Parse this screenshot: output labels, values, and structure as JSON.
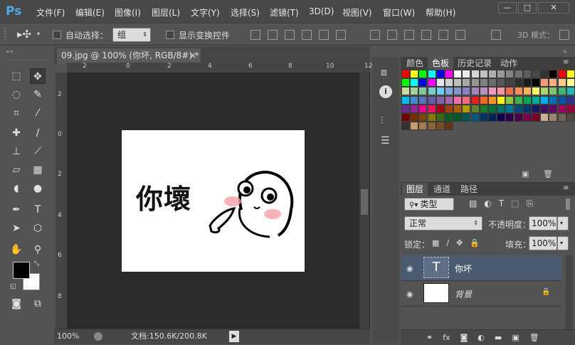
{
  "app": {
    "logo": "Ps"
  },
  "menu": [
    "文件(F)",
    "编辑(E)",
    "图像(I)",
    "图层(L)",
    "文字(Y)",
    "选择(S)",
    "滤镜(T)",
    "3D(D)",
    "视图(V)",
    "窗口(W)",
    "帮助(H)"
  ],
  "window_controls": {
    "minimize": "—",
    "maximize": "□",
    "close": "✕"
  },
  "options": {
    "auto_select_label": "自动选择：",
    "auto_select_value": "组",
    "show_transform_label": "显示变换控件",
    "mode_3d_label": "3D 模式："
  },
  "document": {
    "tab_title": "09.jpg @ 100% (你坏, RGB/8#) *",
    "close": "×",
    "zoom": "100%",
    "doc_size": "文档:150.6K/200.8K",
    "ruler_h_labels": [
      "2",
      "0",
      "2",
      "4",
      "6",
      "8",
      "10",
      "12"
    ],
    "ruler_v_labels": [
      "2",
      "0",
      "2",
      "4",
      "6",
      "8"
    ],
    "canvas_text": "你壞"
  },
  "swatches_panel": {
    "tabs": [
      "颜色",
      "色板",
      "历史记录",
      "动作"
    ],
    "active_tab": "色板",
    "colors": [
      [
        "#ff0000",
        "#ffff00",
        "#00ff00",
        "#00ffff",
        "#0000ff",
        "#ff00ff",
        "#ffffff",
        "#ebebeb",
        "#d6d6d6",
        "#c2c2c2",
        "#adadad",
        "#999999",
        "#858585",
        "#707070",
        "#5c5c5c",
        "#474747",
        "#333333",
        "#000000",
        "#ff0000",
        "#ffff00"
      ],
      [
        "#00ff00",
        "#00ffff",
        "#0000ff",
        "#ff00ff",
        "#e6e6e6",
        "#d1d1d1",
        "#bdbdbd",
        "#a8a8a8",
        "#949494",
        "#808080",
        "#6b6b6b",
        "#575757",
        "#424242",
        "#2e2e2e",
        "#1a1a1a",
        "#000000",
        "#f7977a",
        "#f9ad81",
        "#fdc68a",
        "#fff79a"
      ],
      [
        "#c4df9b",
        "#a2d39c",
        "#82ca9d",
        "#7bcdc8",
        "#6ecff6",
        "#7ea7d8",
        "#8493ca",
        "#8882be",
        "#a187be",
        "#bc8dbf",
        "#f49ac2",
        "#f6989d",
        "#f26c4f",
        "#f68e55",
        "#fbaf5c",
        "#fff467",
        "#acd372",
        "#7cc576",
        "#3bb878",
        "#1abbb4"
      ],
      [
        "#00bff3",
        "#438ccb",
        "#5574b9",
        "#605ca8",
        "#855fa8",
        "#a763a8",
        "#f06eaa",
        "#f26d7d",
        "#ed1c24",
        "#f26522",
        "#f7941d",
        "#fff200",
        "#8dc73f",
        "#39b54a",
        "#00a651",
        "#00a99d",
        "#00aeef",
        "#0072bc",
        "#0054a6",
        "#2e3192"
      ],
      [
        "#662d91",
        "#92278f",
        "#ec008c",
        "#ed145b",
        "#9e0b0f",
        "#a0410d",
        "#a3620a",
        "#aba000",
        "#598527",
        "#1a7b30",
        "#007236",
        "#00746b",
        "#0076a3",
        "#004b80",
        "#003471",
        "#1b1464",
        "#440e62",
        "#630460",
        "#9e005d",
        "#9e0039"
      ],
      [
        "#790000",
        "#7b2e00",
        "#7d4900",
        "#827b00",
        "#406618",
        "#005e20",
        "#005826",
        "#005952",
        "#005b7f",
        "#003663",
        "#002157",
        "#0d004c",
        "#32004b",
        "#4b0049",
        "#7b0046",
        "#7a0026",
        "#c7b299",
        "#998675",
        "#736357",
        "#534741"
      ],
      [
        "#362f2d",
        "#c69c6d",
        "#a67c52",
        "#8c6239",
        "#754c24",
        "#603913"
      ]
    ]
  },
  "layers_panel": {
    "tabs": [
      "图层",
      "通道",
      "路径"
    ],
    "active_tab": "图层",
    "kind_label": "类型",
    "blend_mode": "正常",
    "opacity_label": "不透明度：",
    "opacity_value": "100%",
    "lock_label": "锁定：",
    "fill_label": "填充：",
    "fill_value": "100%",
    "layers": [
      {
        "name": "你坏",
        "type": "text",
        "thumb": "T",
        "selected": true
      },
      {
        "name": "背景",
        "type": "image",
        "selected": false,
        "locked": true
      }
    ]
  },
  "colors": {
    "fg": "#000000",
    "bg": "#ffffff",
    "accent": "#4a5a70"
  }
}
